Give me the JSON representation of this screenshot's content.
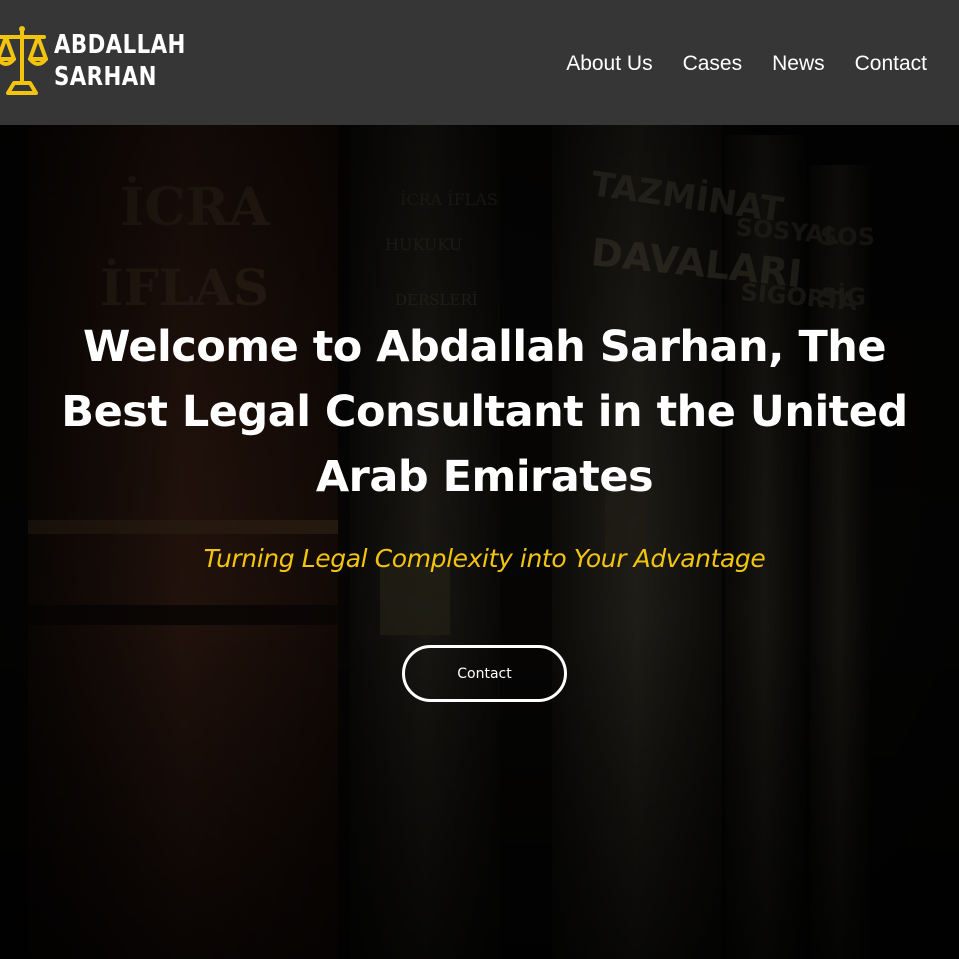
{
  "brand": {
    "name_line1": "ABDALLAH",
    "name_line2": "SARHAN",
    "icon": "scales-of-justice-icon",
    "accent_color": "#f2c40f"
  },
  "nav": {
    "items": [
      {
        "label": "About Us"
      },
      {
        "label": "Cases"
      },
      {
        "label": "News"
      },
      {
        "label": "Contact"
      }
    ]
  },
  "hero": {
    "title": "Welcome to Abdallah Sarhan, The Best Legal Consultant in the United Arab Emirates",
    "subtitle": "Turning Legal Complexity into Your Advantage",
    "cta_label": "Contact",
    "background": "law-books-photo",
    "book_spines": [
      "İCRA İFLAS",
      "İCRA İFLAS HUKUKU DERSLERİ",
      "TAZMİNAT DAVALARI",
      "SOSYAL SİGORTA",
      "SOS SİG"
    ]
  }
}
